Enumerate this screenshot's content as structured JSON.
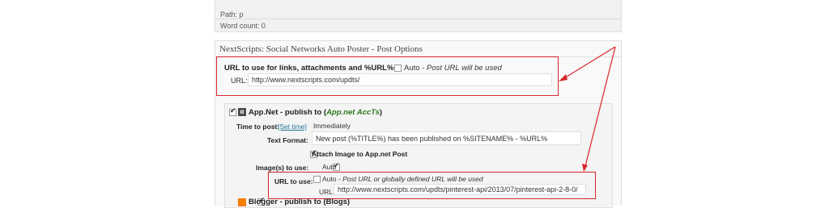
{
  "editor": {
    "path_text": "Path: p",
    "word_count_text": "Word count: 0"
  },
  "metabox": {
    "title": "NextScripts: Social Networks Auto Poster - Post Options"
  },
  "url_section": {
    "heading": "URL to use for links, attachments and %URL%:",
    "auto_label": "Auto",
    "auto_hint": "Post URL will be used",
    "url_label": "URL:",
    "url_value": "http://www.nextscripts.com/updts/"
  },
  "appnet": {
    "icon_text": "α",
    "name": "App.Net",
    "publish_to": " - publish to (",
    "accts_label": "App.net AccTs",
    "close_paren": ")",
    "time_label": "Time to post:",
    "set_time": "[Set time]",
    "time_value": "Immediately",
    "text_format_label": "Text Format:",
    "text_format_value": "New post (%TITLE%) has been published on %SITENAME% - %URL%",
    "attach_label": "Attach Image to App.net Post",
    "images_label": "Image(s) to use:",
    "images_auto": "Auto",
    "url_to_use_label": "URL to use:",
    "url_auto_label": "Auto",
    "url_auto_hint": "Post URL or globally defined URL will be used",
    "url_label": "URL:",
    "url_value": "http://www.nextscripts.com/updts/pinterest-api/2013/07/pinterest-api-2-8-0/"
  },
  "blogger": {
    "label": "Blogger - publish to (Blogs)"
  },
  "colors": {
    "annotation_red": "#d9262c",
    "accts_green": "#2d7a1f",
    "link_blue": "#21759b"
  }
}
